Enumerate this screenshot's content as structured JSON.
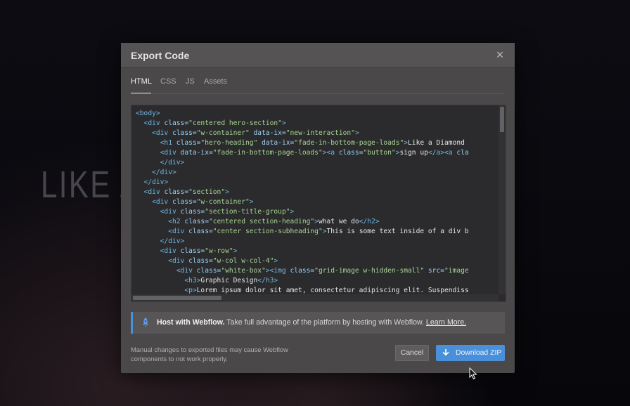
{
  "background": {
    "hero_text": "LIKE A"
  },
  "modal": {
    "title": "Export Code",
    "close_label": "×",
    "tabs": [
      {
        "label": "HTML",
        "active": true
      },
      {
        "label": "CSS",
        "active": false
      },
      {
        "label": "JS",
        "active": false
      },
      {
        "label": "Assets",
        "active": false
      }
    ]
  },
  "code": {
    "lines": [
      [
        {
          "t": "t",
          "v": "<body>"
        }
      ],
      [
        {
          "t": "p",
          "v": "  "
        },
        {
          "t": "t",
          "v": "<div "
        },
        {
          "t": "a",
          "v": "class="
        },
        {
          "t": "s",
          "v": "\"centered hero-section\""
        },
        {
          "t": "t",
          "v": ">"
        }
      ],
      [
        {
          "t": "p",
          "v": "    "
        },
        {
          "t": "t",
          "v": "<div "
        },
        {
          "t": "a",
          "v": "class="
        },
        {
          "t": "s",
          "v": "\"w-container\""
        },
        {
          "t": "p",
          "v": " "
        },
        {
          "t": "a",
          "v": "data-ix="
        },
        {
          "t": "s",
          "v": "\"new-interaction\""
        },
        {
          "t": "t",
          "v": ">"
        }
      ],
      [
        {
          "t": "p",
          "v": "      "
        },
        {
          "t": "t",
          "v": "<h1 "
        },
        {
          "t": "a",
          "v": "class="
        },
        {
          "t": "s",
          "v": "\"hero-heading\""
        },
        {
          "t": "p",
          "v": " "
        },
        {
          "t": "a",
          "v": "data-ix="
        },
        {
          "t": "s",
          "v": "\"fade-in-bottom-page-loads\""
        },
        {
          "t": "t",
          "v": ">"
        },
        {
          "t": "p",
          "v": "Like a Diamond"
        }
      ],
      [
        {
          "t": "p",
          "v": "      "
        },
        {
          "t": "t",
          "v": "<div "
        },
        {
          "t": "a",
          "v": "data-ix="
        },
        {
          "t": "s",
          "v": "\"fade-in-bottom-page-loads\""
        },
        {
          "t": "t",
          "v": "><a "
        },
        {
          "t": "a",
          "v": "class="
        },
        {
          "t": "s",
          "v": "\"button\""
        },
        {
          "t": "t",
          "v": ">"
        },
        {
          "t": "p",
          "v": "sign up"
        },
        {
          "t": "t",
          "v": "</a><a "
        },
        {
          "t": "a",
          "v": "cla"
        }
      ],
      [
        {
          "t": "p",
          "v": "      "
        },
        {
          "t": "t",
          "v": "</div>"
        }
      ],
      [
        {
          "t": "p",
          "v": "    "
        },
        {
          "t": "t",
          "v": "</div>"
        }
      ],
      [
        {
          "t": "p",
          "v": "  "
        },
        {
          "t": "t",
          "v": "</div>"
        }
      ],
      [
        {
          "t": "p",
          "v": "  "
        },
        {
          "t": "t",
          "v": "<div "
        },
        {
          "t": "a",
          "v": "class="
        },
        {
          "t": "s",
          "v": "\"section\""
        },
        {
          "t": "t",
          "v": ">"
        }
      ],
      [
        {
          "t": "p",
          "v": "    "
        },
        {
          "t": "t",
          "v": "<div "
        },
        {
          "t": "a",
          "v": "class="
        },
        {
          "t": "s",
          "v": "\"w-container\""
        },
        {
          "t": "t",
          "v": ">"
        }
      ],
      [
        {
          "t": "p",
          "v": "      "
        },
        {
          "t": "t",
          "v": "<div "
        },
        {
          "t": "a",
          "v": "class="
        },
        {
          "t": "s",
          "v": "\"section-title-group\""
        },
        {
          "t": "t",
          "v": ">"
        }
      ],
      [
        {
          "t": "p",
          "v": "        "
        },
        {
          "t": "t",
          "v": "<h2 "
        },
        {
          "t": "a",
          "v": "class="
        },
        {
          "t": "s",
          "v": "\"centered section-heading\""
        },
        {
          "t": "t",
          "v": ">"
        },
        {
          "t": "p",
          "v": "what we do"
        },
        {
          "t": "t",
          "v": "</h2>"
        }
      ],
      [
        {
          "t": "p",
          "v": "        "
        },
        {
          "t": "t",
          "v": "<div "
        },
        {
          "t": "a",
          "v": "class="
        },
        {
          "t": "s",
          "v": "\"center section-subheading\""
        },
        {
          "t": "t",
          "v": ">"
        },
        {
          "t": "p",
          "v": "This is some text inside of a div b"
        }
      ],
      [
        {
          "t": "p",
          "v": "      "
        },
        {
          "t": "t",
          "v": "</div>"
        }
      ],
      [
        {
          "t": "p",
          "v": "      "
        },
        {
          "t": "t",
          "v": "<div "
        },
        {
          "t": "a",
          "v": "class="
        },
        {
          "t": "s",
          "v": "\"w-row\""
        },
        {
          "t": "t",
          "v": ">"
        }
      ],
      [
        {
          "t": "p",
          "v": "        "
        },
        {
          "t": "t",
          "v": "<div "
        },
        {
          "t": "a",
          "v": "class="
        },
        {
          "t": "s",
          "v": "\"w-col w-col-4\""
        },
        {
          "t": "t",
          "v": ">"
        }
      ],
      [
        {
          "t": "p",
          "v": "          "
        },
        {
          "t": "t",
          "v": "<div "
        },
        {
          "t": "a",
          "v": "class="
        },
        {
          "t": "s",
          "v": "\"white-box\""
        },
        {
          "t": "t",
          "v": "><img "
        },
        {
          "t": "a",
          "v": "class="
        },
        {
          "t": "s",
          "v": "\"grid-image w-hidden-small\""
        },
        {
          "t": "p",
          "v": " "
        },
        {
          "t": "a",
          "v": "src="
        },
        {
          "t": "s",
          "v": "\"image"
        }
      ],
      [
        {
          "t": "p",
          "v": "            "
        },
        {
          "t": "t",
          "v": "<h3>"
        },
        {
          "t": "p",
          "v": "Graphic Design"
        },
        {
          "t": "t",
          "v": "</h3>"
        }
      ],
      [
        {
          "t": "p",
          "v": "            "
        },
        {
          "t": "t",
          "v": "<p>"
        },
        {
          "t": "p",
          "v": "Lorem ipsum dolor sit amet, consectetur adipiscing elit. Suspendiss"
        }
      ]
    ]
  },
  "host": {
    "title": "Host with Webflow.",
    "text": " Take full advantage of the platform by hosting with Webflow. ",
    "link": "Learn More."
  },
  "footer": {
    "note": "Manual changes to exported files may cause Webflow components to not work properly.",
    "cancel_label": "Cancel",
    "download_label": "Download ZIP"
  },
  "colors": {
    "accent": "#4a90e2",
    "download_button": "#4a8fd9",
    "code_bg": "#2b2b2e",
    "modal_bg": "#4a4849"
  },
  "icons": {
    "close": "close-icon",
    "host": "rocket-icon",
    "download": "download-icon"
  }
}
